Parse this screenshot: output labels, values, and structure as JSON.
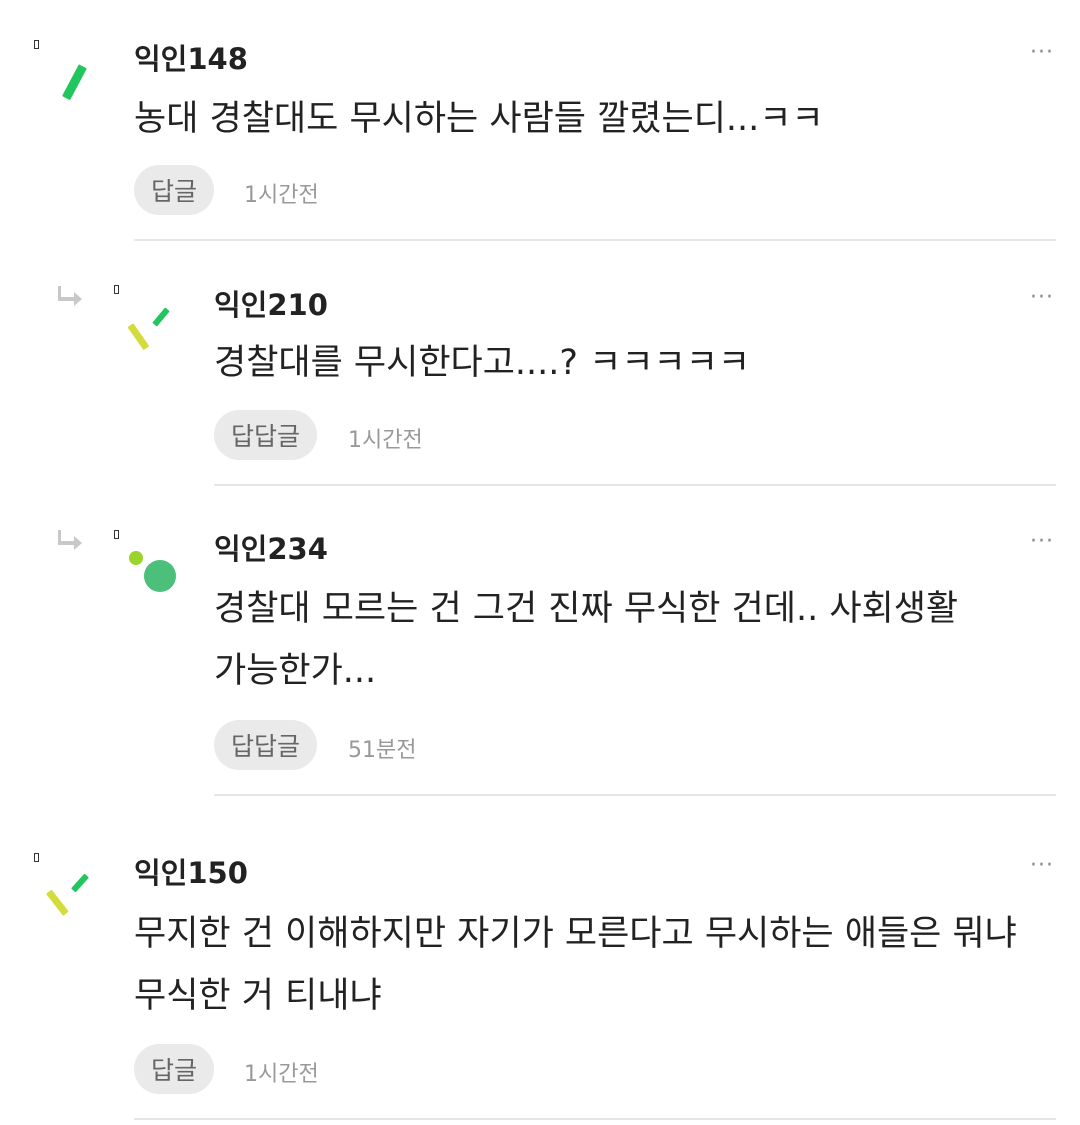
{
  "comments": [
    {
      "nick": "익인148",
      "text": "농대 경찰대도 무시하는 사람들 깔렸는디...ㅋㅋ",
      "reply_label": "답글",
      "time": "1시간전",
      "more": "···"
    },
    {
      "nick": "익인210",
      "text": "경찰대를 무시한다고....? ㅋㅋㅋㅋㅋ",
      "reply_label": "답답글",
      "time": "1시간전",
      "more": "···"
    },
    {
      "nick": "익인234",
      "text": "경찰대 모르는 건 그건 진짜 무식한 건데.. 사회생활 가능한가...",
      "reply_label": "답답글",
      "time": "51분전",
      "more": "···"
    },
    {
      "nick": "익인150",
      "text": "무지한 건 이해하지만 자기가 모른다고 무시하는 애들은 뭐냐 무식한 거 티내냐",
      "reply_label": "답글",
      "time": "1시간전",
      "more": "···"
    }
  ],
  "colors": {
    "green": "#22c55e",
    "lime": "#d4dc3a",
    "avatar_dot": "#4cbf7a"
  },
  "icons": [
    "reply-arrow-icon",
    "more-icon"
  ]
}
